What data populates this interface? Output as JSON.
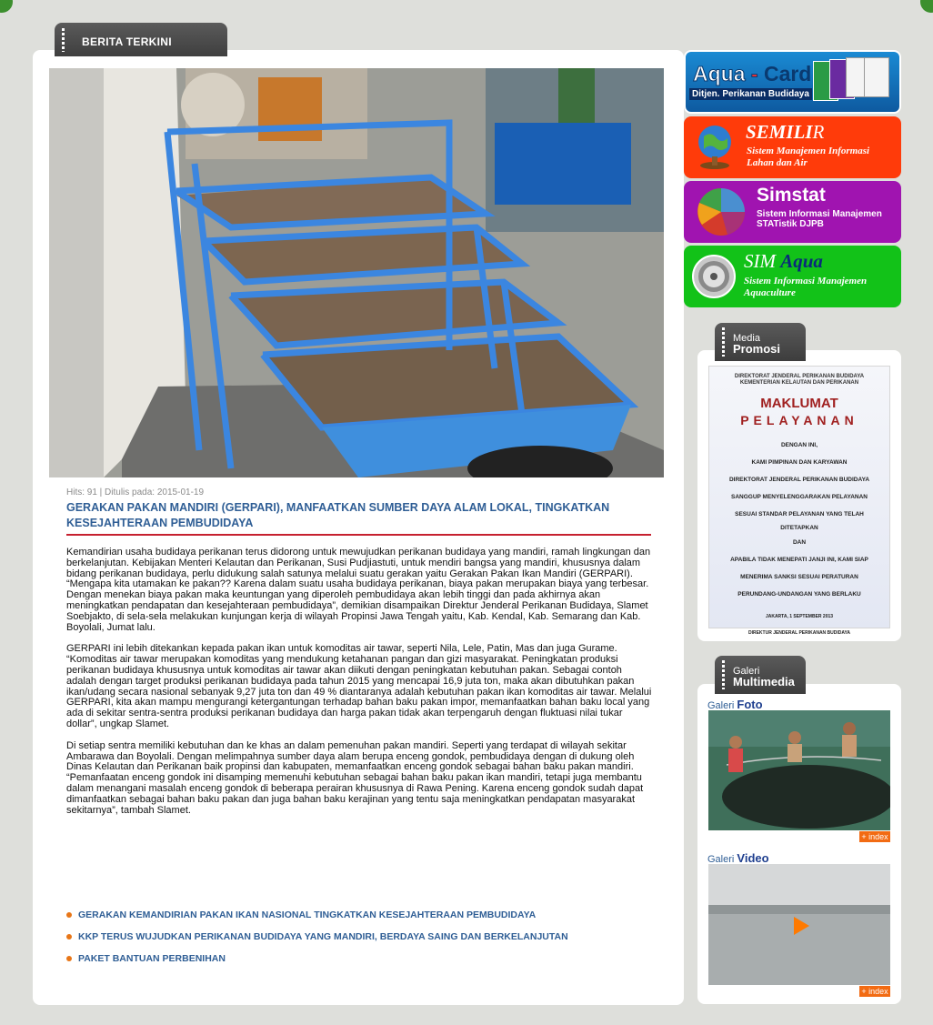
{
  "header": {
    "section_title": "BERITA TERKINI"
  },
  "article": {
    "meta": "Hits: 91 | Ditulis pada: 2015-01-19",
    "title": "GERAKAN PAKAN MANDIRI (GERPARI), MANFAATKAN SUMBER DAYA ALAM LOKAL, TINGKATKAN KESEJAHTERAAN PEMBUDIDAYA",
    "paragraphs": [
      "Kemandirian usaha budidaya perikanan terus didorong untuk mewujudkan perikanan budidaya yang mandiri, ramah lingkungan dan berkelanjutan. Kebijakan Menteri Kelautan dan Perikanan, Susi Pudjiastuti, untuk mendiri bangsa yang mandiri, khususnya dalam bidang perikanan budidaya, perlu didukung salah satunya melalui suatu gerakan yaitu Gerakan Pakan Ikan Mandiri (GERPARI). “Mengapa kita utamakan ke pakan?? Karena dalam suatu usaha budidaya perikanan, biaya pakan merupakan biaya yang terbesar. Dengan menekan biaya pakan maka keuntungan yang diperoleh pembudidaya akan lebih tinggi dan pada akhirnya akan meningkatkan pendapatan dan kesejahteraan pembudidaya”, demikian disampaikan Direktur Jenderal Perikanan Budidaya, Slamet Soebjakto, di sela-sela melakukan kunjungan kerja di wilayah Propinsi Jawa Tengah yaitu, Kab. Kendal, Kab. Semarang dan Kab. Boyolali, Jumat lalu.",
      "GERPARI ini lebih ditekankan kepada pakan ikan untuk komoditas air tawar, seperti Nila, Lele, Patin, Mas dan juga Gurame. “Komoditas air tawar merupakan komoditas yang mendukung ketahanan pangan dan gizi masyarakat. Peningkatan produksi perikanan budidaya khususnya untuk komoditas air tawar akan diikuti dengan peningkatan kebutuhan pakan. Sebagai contoh adalah dengan target produksi perikanan budidaya pada tahun 2015 yang mencapai 16,9 juta ton, maka akan dibutuhkan pakan ikan/udang secara nasional sebanyak 9,27 juta ton dan 49 % diantaranya adalah kebutuhan pakan ikan komoditas air tawar. Melalui GERPARI, kita akan mampu mengurangi ketergantungan terhadap bahan baku pakan impor, memanfaatkan bahan baku local yang ada di sekitar sentra-sentra produksi perikanan budidaya dan harga pakan tidak akan terpengaruh dengan fluktuasi nilai tukar dollar”, ungkap Slamet.",
      "Di setiap sentra memiliki kebutuhan dan ke khas an dalam pemenuhan pakan mandiri. Seperti yang terdapat di wilayah sekitar Ambarawa dan Boyolali. Dengan melimpahnya sumber daya alam berupa enceng gondok, pembudidaya dengan di dukung oleh Dinas Kelautan dan Perikanan baik propinsi dan kabupaten, memanfaatkan enceng gondok sebagai bahan baku pakan mandiri. “Pemanfaatan enceng gondok ini disamping memenuhi kebutuhan sebagai bahan baku pakan ikan mandiri, tetapi juga membantu dalam menangani masalah enceng gondok di beberapa perairan khususnya di Rawa Pening. Karena enceng gondok sudah dapat dimanfaatkan sebagai bahan baku pakan dan juga bahan baku kerajinan yang tentu saja meningkatkan pendapatan masyarakat sekitarnya”, tambah Slamet."
    ],
    "related": [
      "GERAKAN KEMANDIRIAN PAKAN IKAN NASIONAL TINGKATKAN KESEJAHTERAAN PEMBUDIDAYA",
      "KKP TERUS WUJUDKAN PERIKANAN BUDIDAYA YANG MANDIRI, BERDAYA SAING DAN BERKELANJUTAN",
      "PAKET BANTUAN PERBENIHAN"
    ]
  },
  "sidebar": {
    "aqua_card": {
      "title_a": "Aqua",
      "dash": "-",
      "title_b": "Card",
      "subtitle": "Ditjen. Perikanan Budidaya"
    },
    "semilir": {
      "title_bold": "SEMILI",
      "title_rest": "R",
      "subtitle": "Sistem Manajemen Informasi Lahan dan Air"
    },
    "simstat": {
      "title": "Simstat",
      "subtitle": "Sistem Informasi Manajemen STATistik DJPB"
    },
    "sim_aqua": {
      "title_a": "SIM ",
      "title_b": "Aqua",
      "subtitle": "Sistem Informasi Manajemen Aquaculture"
    },
    "media_promosi": {
      "tab_line1": "Media",
      "tab_line2": "Promosi",
      "poster": {
        "header1": "DIREKTORAT JENDERAL PERIKANAN BUDIDAYA",
        "header2": "KEMENTERIAN KELAUTAN DAN PERIKANAN",
        "title1": "MAKLUMAT",
        "title2": "PELAYANAN",
        "lines": [
          "DENGAN INI,",
          "KAMI PIMPINAN DAN KARYAWAN",
          "DIREKTORAT JENDERAL PERIKANAN BUDIDAYA",
          "SANGGUP MENYELENGGARAKAN PELAYANAN",
          "SESUAI STANDAR PELAYANAN YANG TELAH",
          "DITETAPKAN",
          "DAN",
          "APABILA TIDAK MENEPATI JANJI INI, KAMI SIAP",
          "MENERIMA SANKSI SESUAI PERATURAN",
          "PERUNDANG-UNDANGAN YANG BERLAKU"
        ],
        "date": "JAKARTA, 1 SEPTEMBER 2013",
        "sign": "DIREKTUR JENDERAL PERIKANAN BUDIDAYA"
      }
    },
    "galeri": {
      "tab_line1": "Galeri",
      "tab_line2": "Multimedia",
      "foto_prefix": "Galeri",
      "foto_label": "Foto",
      "video_prefix": "Galeri",
      "video_label": "Video",
      "index_label": "+ index"
    }
  }
}
